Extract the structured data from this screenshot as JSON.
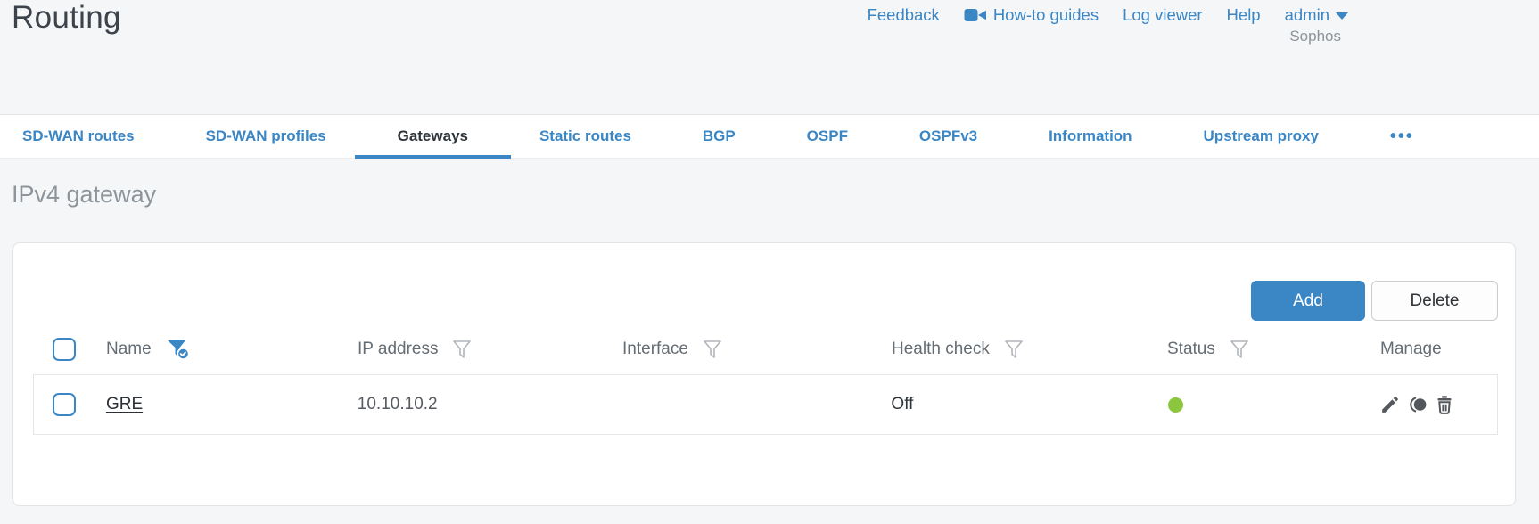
{
  "page": {
    "title": "Routing",
    "brand": "Sophos"
  },
  "header_nav": {
    "feedback": "Feedback",
    "howto_guides": "How-to guides",
    "log_viewer": "Log viewer",
    "help": "Help",
    "user": "admin"
  },
  "tabs": {
    "items": [
      {
        "label": "SD-WAN routes",
        "active": false
      },
      {
        "label": "SD-WAN profiles",
        "active": false
      },
      {
        "label": "Gateways",
        "active": true
      },
      {
        "label": "Static routes",
        "active": false
      },
      {
        "label": "BGP",
        "active": false
      },
      {
        "label": "OSPF",
        "active": false
      },
      {
        "label": "OSPFv3",
        "active": false
      },
      {
        "label": "Information",
        "active": false
      },
      {
        "label": "Upstream proxy",
        "active": false
      }
    ],
    "more_label": "•••"
  },
  "section": {
    "title": "IPv4 gateway"
  },
  "toolbar": {
    "add_label": "Add",
    "delete_label": "Delete"
  },
  "table": {
    "columns": [
      {
        "label": "Name",
        "filter": "active"
      },
      {
        "label": "IP address",
        "filter": "inactive"
      },
      {
        "label": "Interface",
        "filter": "inactive"
      },
      {
        "label": "Health check",
        "filter": "inactive"
      },
      {
        "label": "Status",
        "filter": "inactive"
      },
      {
        "label": "Manage",
        "filter": "none"
      }
    ],
    "rows": [
      {
        "name": "GRE",
        "ip_address": "10.10.10.2",
        "interface": "",
        "health_check": "Off",
        "status": "up"
      }
    ]
  },
  "colors": {
    "accent_blue": "#3b86c4",
    "status_green": "#8cc63e"
  }
}
